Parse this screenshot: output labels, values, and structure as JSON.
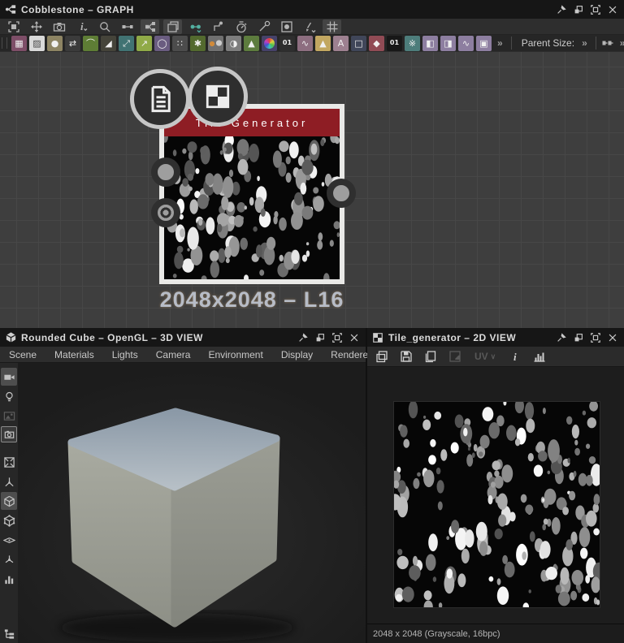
{
  "window": {
    "title": "Cobblestone – GRAPH",
    "controls": [
      "pin",
      "restore",
      "maximize",
      "close"
    ]
  },
  "main_toolbar": {
    "tools": [
      {
        "name": "marquee-select"
      },
      {
        "name": "fit-1-1"
      },
      {
        "name": "screenshot-camera"
      },
      {
        "name": "info-display"
      },
      {
        "name": "search-zoom"
      },
      {
        "name": "link-tool"
      },
      {
        "name": "graph-view",
        "active": true
      },
      {
        "name": "stacked-windows",
        "active": true
      },
      {
        "name": "create-link"
      },
      {
        "name": "connector-elbow"
      },
      {
        "name": "timer"
      },
      {
        "name": "tools-wrench"
      },
      {
        "name": "thumbnail-display"
      },
      {
        "name": "cleanup-brush"
      },
      {
        "name": "grid-snap",
        "active": true
      }
    ]
  },
  "node_toolbar": {
    "items": [
      {
        "name": "bitmap",
        "color": "#7e4e68",
        "glyph": "▦"
      },
      {
        "name": "svg-node",
        "color": "#d9d9d9",
        "glyph": "▨",
        "glyph_color": "#4a4a4a"
      },
      {
        "name": "blur",
        "color": "#8d8463",
        "glyph": "●"
      },
      {
        "name": "directional-blur",
        "color": "#3b3b3b",
        "glyph": "⇄"
      },
      {
        "name": "levels",
        "color": "#5e7d35",
        "glyph": "⌒"
      },
      {
        "name": "slope-blur",
        "color": "#45443a",
        "glyph": "◢"
      },
      {
        "name": "transformation-2d",
        "color": "#417373",
        "glyph": "⤢"
      },
      {
        "name": "directional-warp",
        "color": "#90aa47",
        "glyph": "↗"
      },
      {
        "name": "shape",
        "color": "#6a5c80",
        "glyph": "◯"
      },
      {
        "name": "splatter",
        "color": "#4c4c4c",
        "glyph": "∷"
      },
      {
        "name": "grunge-map",
        "color": "#536a2f",
        "glyph": "✱"
      },
      {
        "name": "blend",
        "color": "#707070",
        "glyph": "",
        "css": "blend"
      },
      {
        "name": "gradient-map",
        "color": "#7d7d7d",
        "glyph": "◑"
      },
      {
        "name": "histogram-scan",
        "color": "#5d7c3e",
        "glyph": "▲"
      },
      {
        "name": "hsl",
        "color": "#46426a",
        "glyph": "",
        "css": "wheel"
      },
      {
        "name": "grayscale-conversion",
        "color": "#2e2e2e",
        "glyph": "01",
        "small": true
      },
      {
        "name": "curve",
        "color": "#8d6e80",
        "glyph": "∿"
      },
      {
        "name": "highpass",
        "color": "#c2a761",
        "glyph": "▲"
      },
      {
        "name": "text",
        "color": "#9d8090",
        "glyph": "A"
      },
      {
        "name": "crop",
        "color": "#404659",
        "glyph": "□"
      },
      {
        "name": "flood-fill",
        "color": "#914b55",
        "glyph": "◆"
      },
      {
        "name": "quantize",
        "color": "#181818",
        "glyph": "01",
        "small": true
      },
      {
        "name": "bnw-spots",
        "color": "#4d7d7b",
        "glyph": "※"
      },
      {
        "name": "uniform-color",
        "color": "#8d7ea0",
        "glyph": "◧"
      },
      {
        "name": "gradient-linear",
        "color": "#8d7ea0",
        "glyph": "◨"
      },
      {
        "name": "curve-smooth",
        "color": "#8d7ea0",
        "glyph": "∿"
      },
      {
        "name": "transform-node",
        "color": "#8d7ea0",
        "glyph": "▣"
      }
    ],
    "overflow_label": "»",
    "parent_size_label": "Parent Size:",
    "parent_size_chevron": "»",
    "link_overflow_label": "»"
  },
  "graph": {
    "node": {
      "title": "Tile Generator",
      "caption": "2048x2048 – L16",
      "header_color": "#8e1d24",
      "badges": [
        {
          "name": "document-badge"
        },
        {
          "name": "checker-badge"
        }
      ]
    }
  },
  "view3d": {
    "title": "Rounded Cube – OpenGL – 3D VIEW",
    "menu": [
      "Scene",
      "Materials",
      "Lights",
      "Camera",
      "Environment",
      "Display",
      "Renderer"
    ],
    "side_tools": [
      {
        "name": "scene-camera",
        "active": true
      },
      {
        "name": "light-bulb"
      },
      {
        "name": "environment-image",
        "dim": true
      },
      {
        "name": "camera-frame",
        "framed": true
      },
      {
        "name": "separator"
      },
      {
        "name": "fit-view"
      },
      {
        "name": "axes-gizmo"
      },
      {
        "name": "geometry-cube",
        "active": true
      },
      {
        "name": "wireframe-cube"
      },
      {
        "name": "ground-plane"
      },
      {
        "name": "turntable-fan"
      },
      {
        "name": "stats-bars"
      }
    ],
    "bottom_tool": {
      "name": "scene-tree"
    }
  },
  "view2d": {
    "title": "Tile_generator – 2D VIEW",
    "toolbar": [
      {
        "name": "copy-image"
      },
      {
        "name": "save-image"
      },
      {
        "name": "duplicate-image"
      },
      {
        "name": "export-transform",
        "dim": true
      },
      {
        "name": "uv-dropdown",
        "dim": true,
        "label": "UV",
        "chevron": "∨"
      },
      {
        "name": "information"
      },
      {
        "name": "histogram"
      }
    ],
    "status": "2048 x 2048 (Grayscale, 16bpc)"
  }
}
